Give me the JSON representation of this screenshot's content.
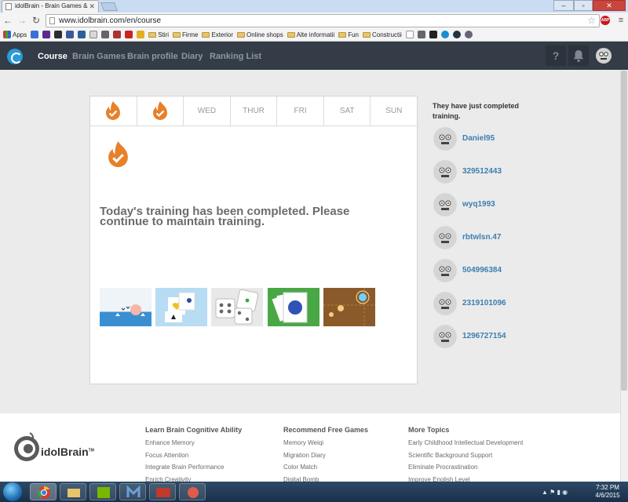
{
  "browser": {
    "tab_title": "idolBrain - Brain Games &",
    "url": "www.idolbrain.com/en/course",
    "bookmarks": [
      "Apps",
      "Stiri",
      "Firme",
      "Exterior",
      "Online shops",
      "Alte informatii",
      "Fun",
      "Constructii"
    ],
    "abp_label": "ABP"
  },
  "site": {
    "nav": [
      "Course",
      "Brain Games",
      "Brain profile",
      "Diary",
      "Ranking List"
    ],
    "help_label": "?"
  },
  "week": {
    "days": [
      "",
      "",
      "WED",
      "THUR",
      "FRI",
      "SAT",
      "SUN"
    ],
    "completed": [
      true,
      true,
      false,
      false,
      false,
      false,
      false
    ]
  },
  "main": {
    "message": "Today's training has been completed. Please continue to maintain training.",
    "games": [
      "seascape-game",
      "cards-game",
      "dice-game",
      "circle-card-game",
      "light-path-game"
    ]
  },
  "sidebar": {
    "title": "They have just completed training.",
    "users": [
      "Daniel95",
      "329512443",
      "wyq1993",
      "rbtwlsn.47",
      "504996384",
      "2319101096",
      "1296727154"
    ]
  },
  "footer": {
    "brand": "idolBrain",
    "trademark": "TM",
    "columns": [
      {
        "title": "Learn Brain Cognitive Ability",
        "links": [
          "Enhance Memory",
          "Focus Attention",
          "Integrate Brain Performance",
          "Enrich Creativity"
        ]
      },
      {
        "title": "Recommend Free Games",
        "links": [
          "Memory Weiqi",
          "Migration Diary",
          "Color Match",
          "Digital Bomb"
        ]
      },
      {
        "title": "More Topics",
        "links": [
          "Early Childhood Intellectual Development",
          "Scientific Background Support",
          "Eliminate Procrastination",
          "Improve English Level"
        ]
      }
    ]
  },
  "taskbar": {
    "time": "7:32 PM",
    "date": "4/6/2015"
  },
  "colors": {
    "nav_bg": "#333c47",
    "flame": "#e8802a",
    "link": "#3c7fb0"
  }
}
